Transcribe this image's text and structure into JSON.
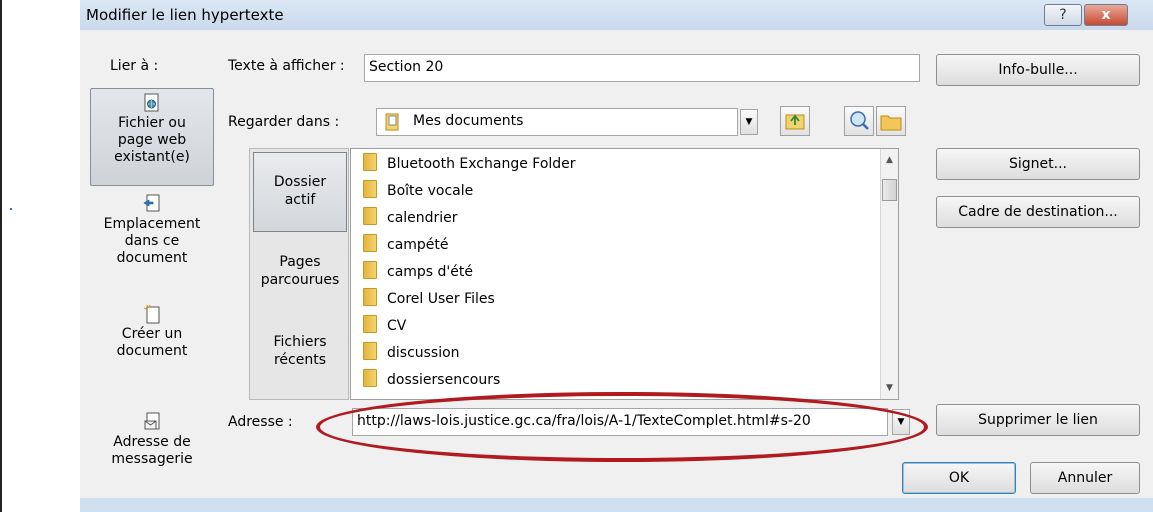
{
  "window": {
    "title": "Modifier le lien hypertexte",
    "help_glyph": "?",
    "close_glyph": "x"
  },
  "link_to": {
    "label": "Lier à :",
    "items": [
      {
        "line1": "Fichier ou",
        "line2": "page web",
        "line3": "existant(e)",
        "icon": "web-page-icon",
        "selected": true
      },
      {
        "line1": "Emplacement",
        "line2": "dans ce",
        "line3": "document",
        "icon": "document-place-icon",
        "selected": false
      },
      {
        "line1": "Créer un",
        "line2": "document",
        "icon": "new-document-icon",
        "selected": false
      },
      {
        "line1": "Adresse de",
        "line2": "messagerie",
        "icon": "email-icon",
        "selected": false
      }
    ]
  },
  "display_text": {
    "label": "Texte à afficher :",
    "value": "Section 20"
  },
  "buttons": {
    "screentip": "Info-bulle...",
    "bookmark": "Signet...",
    "target_frame": "Cadre de destination...",
    "remove_link": "Supprimer le lien",
    "ok": "OK",
    "cancel": "Annuler"
  },
  "look_in": {
    "label": "Regarder dans :",
    "value": "Mes documents",
    "icons": [
      "up-folder-icon",
      "browse-web-icon",
      "browse-file-icon"
    ]
  },
  "shortcuts": [
    {
      "line1": "Dossier",
      "line2": "actif",
      "selected": true
    },
    {
      "line1": "Pages",
      "line2": "parcourues",
      "selected": false
    },
    {
      "line1": "Fichiers",
      "line2": "récents",
      "selected": false
    }
  ],
  "files": [
    "Bluetooth Exchange Folder",
    "Boîte vocale",
    "calendrier",
    "campété",
    "camps d'été",
    "Corel User Files",
    "CV",
    "discussion",
    "dossiersencours"
  ],
  "address": {
    "label": "Adresse :",
    "value": "http://laws-lois.justice.gc.ca/fra/lois/A-1/TexteComplet.html#s-20"
  },
  "colors": {
    "highlight_oval": "#b11a1f",
    "dialog_bg": "#f0f0f0"
  }
}
